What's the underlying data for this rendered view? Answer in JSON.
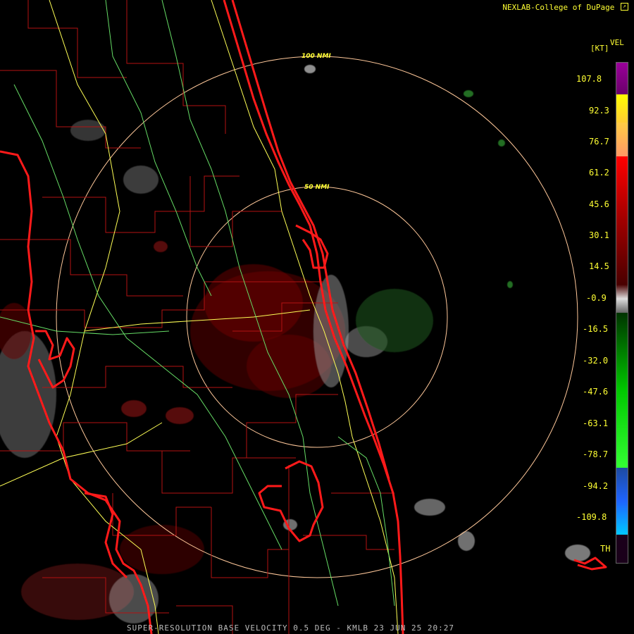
{
  "header": {
    "credit": "NEXLAB-College of DuPage",
    "credit_icon": "arrow-out-icon"
  },
  "footer": {
    "caption": "SUPER-RESOLUTION BASE VELOCITY 0.5 DEG - KMLB 23 JUN 25 20:27"
  },
  "range_rings": [
    {
      "label": "50 NMI"
    },
    {
      "label": "100 NMI"
    }
  ],
  "legend": {
    "product": "VEL",
    "unit": "[KT]",
    "ticks": [
      "107.8",
      "92.3",
      "76.7",
      "61.2",
      "45.6",
      "30.1",
      "14.5",
      "-0.9",
      "-16.5",
      "-32.0",
      "-47.6",
      "-63.1",
      "-78.7",
      "-94.2",
      "-109.8"
    ],
    "threshold_label": "TH",
    "colors": {
      "purple": "#8a008a",
      "yellow": "#ffff00",
      "orange": "#ff9966",
      "red": "#ff0000",
      "dark_red": "#6e0000",
      "gray": "#bdbdbd",
      "green": "#00c800",
      "blue": "#1e64ff",
      "cyan": "#00b4ff",
      "dark_purple": "#1a001a"
    }
  },
  "map_colors": {
    "coastline": "#ff1a1a",
    "county_lines": "#b31212",
    "roads_yellow": "#ffff55",
    "roads_green": "#66dd66",
    "rings": "#ffc89a",
    "ring_labels": "#ffff33"
  }
}
